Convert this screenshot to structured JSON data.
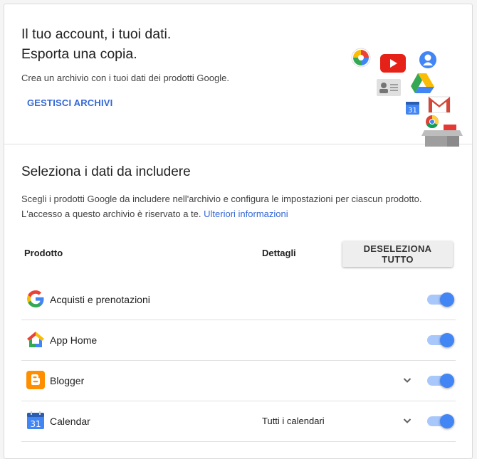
{
  "header": {
    "title_line1": "Il tuo account, i tuoi dati.",
    "title_line2": "Esporta una copia.",
    "subtitle": "Crea un archivio con i tuoi dati dei prodotti Google.",
    "manage_link": "GESTISCI ARCHIVI",
    "calendar_day": "31"
  },
  "selection": {
    "title": "Seleziona i dati da includere",
    "description": "Scegli i prodotti Google da includere nell'archivio e configura le impostazioni per ciascun prodotto. L'accesso a questo archivio è riservato a te.",
    "learn_more": "Ulteriori informazioni",
    "col_product": "Prodotto",
    "col_details": "Dettagli",
    "deselect_all": "DESELEZIONA TUTTO"
  },
  "products": [
    {
      "name": "Acquisti e prenotazioni",
      "icon": "google-g-icon",
      "details": "",
      "expandable": false,
      "enabled": true
    },
    {
      "name": "App Home",
      "icon": "google-home-icon",
      "details": "",
      "expandable": false,
      "enabled": true
    },
    {
      "name": "Blogger",
      "icon": "blogger-icon",
      "details": "",
      "expandable": true,
      "enabled": true
    },
    {
      "name": "Calendar",
      "icon": "calendar-icon",
      "details": "Tutti i calendari",
      "expandable": true,
      "enabled": true,
      "icon_day": "31"
    }
  ],
  "colors": {
    "accent_blue": "#3367d6",
    "toggle_on": "#4285f4",
    "toggle_track": "#a8c7fa"
  }
}
